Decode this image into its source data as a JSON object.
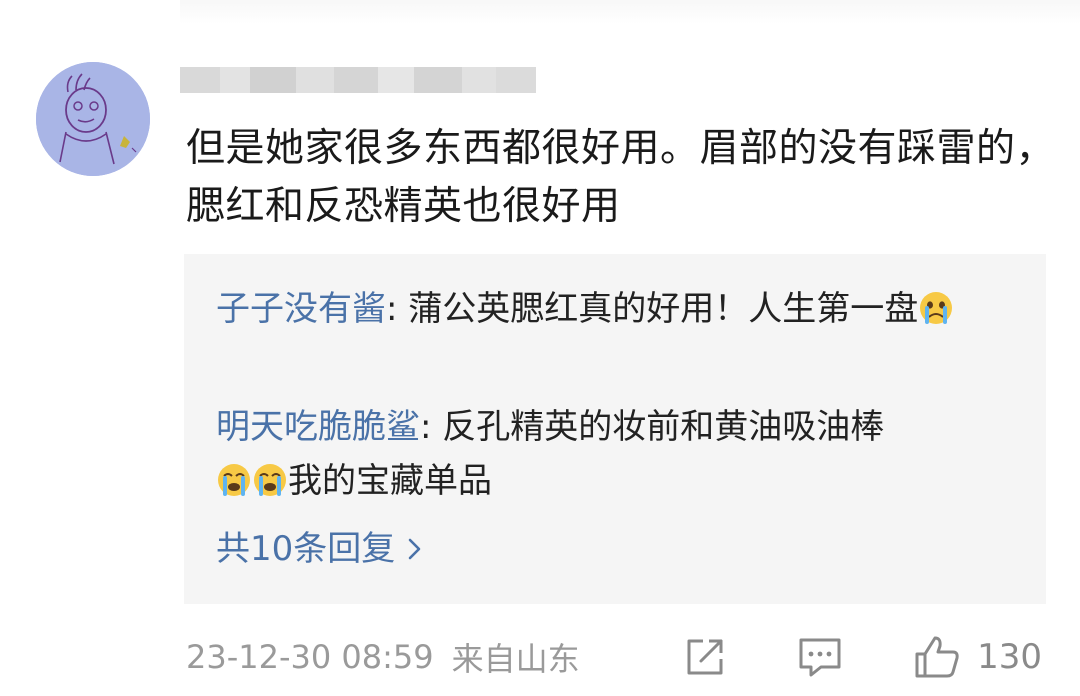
{
  "comment": {
    "text": "但是她家很多东西都很好用。眉部的没有踩雷的，腮红和反恐精英也很好用"
  },
  "replies": [
    {
      "name": "子子没有酱",
      "separator": ": ",
      "text_before_emoji": "蒲公英腮红真的好用！人生第一盘",
      "emojis": [
        "crying-face"
      ],
      "text_after_emoji": ""
    },
    {
      "name": "明天吃脆脆鲨",
      "separator": ": ",
      "text_before_emoji": "反孔精英的妆前和黄油吸油棒",
      "emojis": [
        "crying-face",
        "crying-face"
      ],
      "text_after_emoji": "我的宝藏单品"
    }
  ],
  "more_replies": {
    "label": "共10条回复"
  },
  "footer": {
    "time": "23-12-30 08:59",
    "location": "来自山东",
    "like_count": "130"
  },
  "icons": {
    "share": "share-icon",
    "comment": "comment-icon",
    "like": "thumbs-up-icon",
    "more": "chevron-right-icon"
  },
  "colors": {
    "username_link": "#4a72a8",
    "reply_bg": "#f5f5f5",
    "meta_text": "#9a9a9a",
    "avatar_bg": "#a9b5e6"
  }
}
